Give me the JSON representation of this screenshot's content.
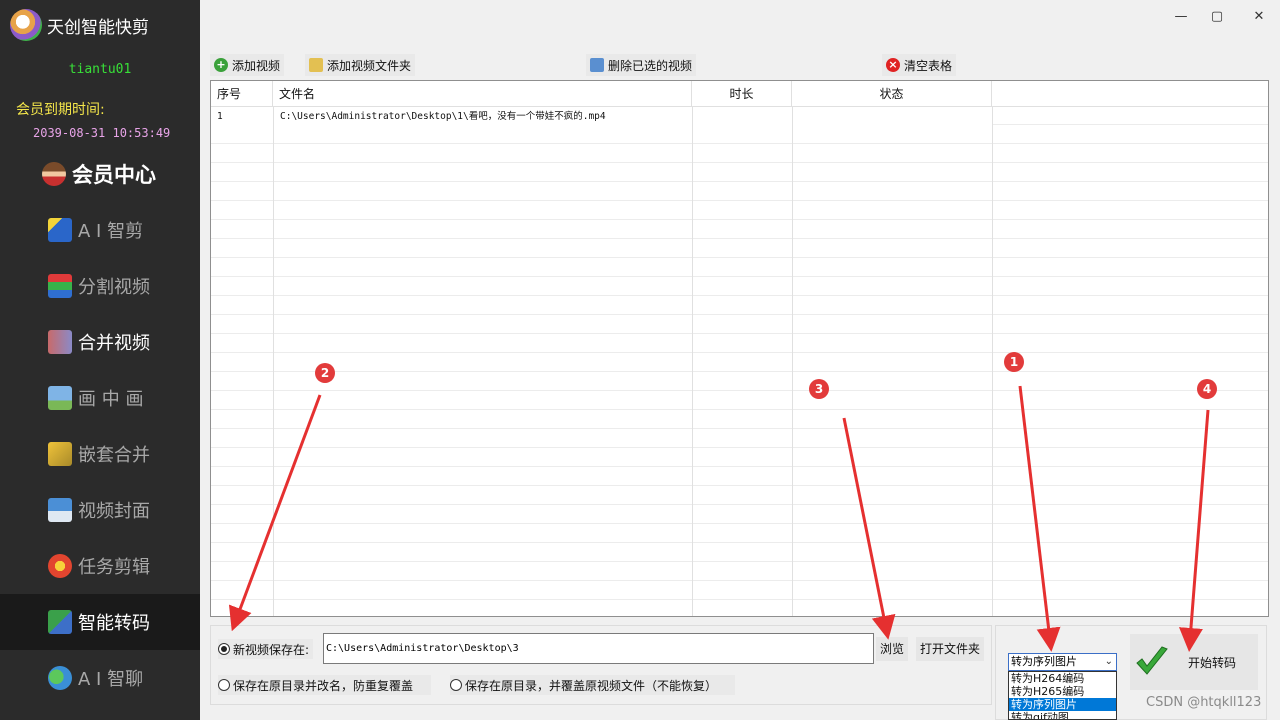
{
  "app": {
    "title": "天创智能快剪",
    "username": "tiantu01",
    "member_label": "会员到期时间:",
    "member_date": "2039-08-31 10:53:49"
  },
  "window": {
    "minimize": "—",
    "maximize": "▢",
    "close": "✕"
  },
  "sidebar": {
    "items": [
      {
        "label": "会员中心"
      },
      {
        "label": "A I 智剪"
      },
      {
        "label": "分割视频"
      },
      {
        "label": "合并视频"
      },
      {
        "label": "画 中 画"
      },
      {
        "label": "嵌套合并"
      },
      {
        "label": "视频封面"
      },
      {
        "label": "任务剪辑"
      },
      {
        "label": "智能转码"
      },
      {
        "label": "A I 智聊"
      }
    ]
  },
  "toolbar": {
    "add_video": "添加视频",
    "add_folder": "添加视频文件夹",
    "delete_selected": "删除已选的视频",
    "clear_table": "清空表格"
  },
  "table": {
    "headers": [
      "序号",
      "文件名",
      "时长",
      "状态"
    ],
    "rows": [
      {
        "index": "1",
        "file": "C:\\Users\\Administrator\\Desktop\\1\\看吧，没有一个带娃不疯的.mp4",
        "duration": "",
        "status": ""
      }
    ]
  },
  "save": {
    "new_location_label": "新视频保存在:",
    "path": "C:\\Users\\Administrator\\Desktop\\3",
    "browse": "浏览",
    "open_folder": "打开文件夹",
    "option_rename": "保存在原目录并改名，防重复覆盖",
    "option_overwrite": "保存在原目录，并覆盖原视频文件（不能恢复）"
  },
  "convert": {
    "selected": "转为序列图片",
    "options": [
      "转为H264编码",
      "转为H265编码",
      "转为序列图片",
      "转为gif动图"
    ],
    "start": "开始转码"
  },
  "annotations": [
    "1",
    "2",
    "3",
    "4"
  ],
  "watermark": "CSDN @htqkll123",
  "colors": {
    "sidebar_bg": "#2b2b2b",
    "active_item": "#1a1a1a",
    "username": "#38e038",
    "member_label": "#f4e64a",
    "member_date": "#e8a4e8",
    "badge": "#e23b3b",
    "select_highlight": "#0078d7"
  }
}
